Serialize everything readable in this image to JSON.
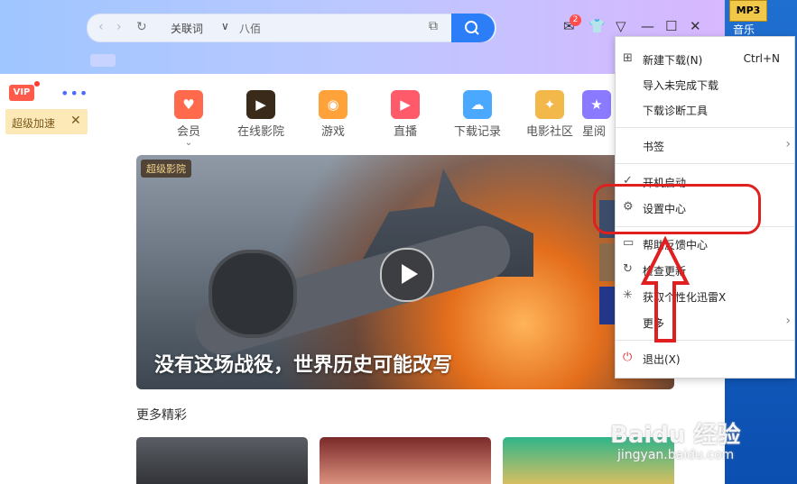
{
  "desktop": {
    "icon_label": "MP3",
    "label": "音乐"
  },
  "search": {
    "keyword_label": "关联词",
    "dropdown": "∨",
    "query": "八佰"
  },
  "notify_count": "2",
  "vip": {
    "label": "VIP",
    "boost_label": "超级加速"
  },
  "categories": [
    {
      "label": "会员",
      "color": "#ff6a4d",
      "icon": "heart-icon"
    },
    {
      "label": "在线影院",
      "color": "#3a2a1a",
      "icon": "film-icon"
    },
    {
      "label": "游戏",
      "color": "#ffa23a",
      "icon": "gamepad-icon"
    },
    {
      "label": "直播",
      "color": "#ff5a6a",
      "icon": "tv-icon"
    },
    {
      "label": "下载记录",
      "color": "#4aa8ff",
      "icon": "cloud-icon"
    },
    {
      "label": "电影社区",
      "color": "#f2b84a",
      "icon": "bird-icon"
    },
    {
      "label": "星阅",
      "color": "#8a7aff",
      "icon": "star-icon"
    }
  ],
  "banner": {
    "badge": "超级影院",
    "title": "没有这场战役，世界历史可能改写"
  },
  "section": {
    "more": "更多精彩"
  },
  "menu": {
    "new_download": "新建下载(N)",
    "new_download_shortcut": "Ctrl+N",
    "import": "导入未完成下载",
    "diagnose": "下载诊断工具",
    "bookmarks": "书签",
    "startup": "开机启动",
    "settings": "设置中心",
    "feedback": "帮助反馈中心",
    "update": "检查更新",
    "skin": "获取个性化迅雷X",
    "more": "更多",
    "exit": "退出(X)"
  },
  "watermark": {
    "brand": "Baidu 经验",
    "url": "jingyan.baidu.com"
  }
}
